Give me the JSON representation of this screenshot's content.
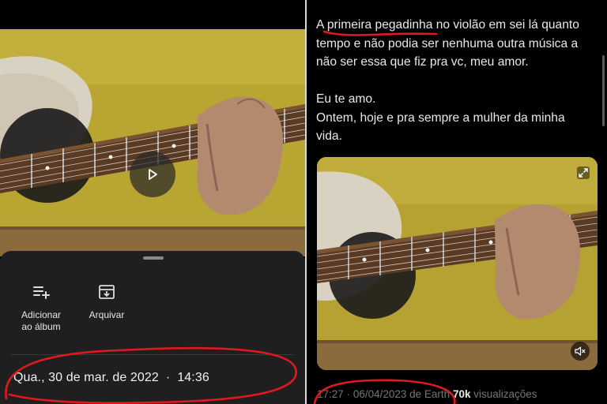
{
  "left_panel": {
    "actions": [
      {
        "label_line1": "Adicionar",
        "label_line2": "ao álbum",
        "icon": "playlist-add-icon"
      },
      {
        "label_line1": "Arquivar",
        "label_line2": "",
        "icon": "archive-icon"
      }
    ],
    "date": "Qua., 30 de mar. de 2022",
    "separator": "·",
    "time": "14:36",
    "play_icon": "play-icon"
  },
  "right_panel": {
    "tweet": {
      "line1_before": "A ",
      "line1_highlight": "primeira pegadinha",
      "line1_after": " no violão em sei lá quanto",
      "line2": "tempo e não podia ser nenhuma outra música a",
      "line3": "não ser essa que fiz pra vc, meu amor.",
      "line4": "Eu te amo.",
      "line5": "Ontem, hoje e pra sempre a mulher da minha",
      "line6": "vida."
    },
    "meta": {
      "time": "17:27",
      "separator": "·",
      "date": "06/04/2023 de Earth",
      "views_count": "70k",
      "views_label": "visualizações"
    },
    "icons": {
      "expand": "expand-icon",
      "mute": "mute-icon"
    }
  },
  "colors": {
    "annotation_red": "#e0191e",
    "shirt_yellow": "#b8a431",
    "text_secondary": "#71767b"
  }
}
